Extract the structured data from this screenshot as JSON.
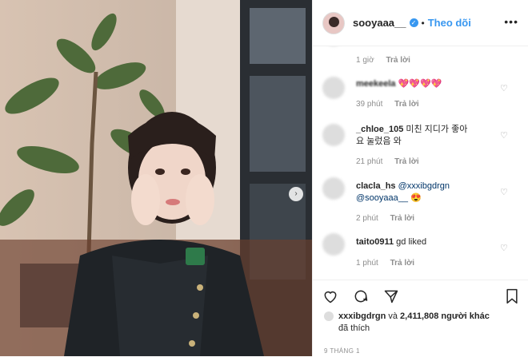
{
  "post": {
    "photo_alt": "photo",
    "next_icon": "chevron-right-icon"
  },
  "header": {
    "username": "sooyaaa__",
    "verified_icon": "verified-badge-icon",
    "separator": "•",
    "follow_label": "Theo dõi",
    "more_icon": "more-options-icon",
    "more_label": "•••"
  },
  "comments": [
    {
      "user": "",
      "text": "",
      "time": "1 giờ",
      "reply": "Trả lời"
    },
    {
      "user": "meekeela",
      "text": "💖💖💖💖",
      "time": "39 phút",
      "reply": "Trả lời"
    },
    {
      "user": "_chloe_105",
      "text": "미친 지디가 좋아요 눌렀음 와",
      "time": "21 phút",
      "reply": "Trả lời"
    },
    {
      "user": "clacla_hs",
      "text_mention1": "@xxxibgdrgn",
      "text_mention2": "@sooyaaa__",
      "text_emoji": "😍",
      "time": "2 phút",
      "reply": "Trả lời"
    },
    {
      "user": "taito0911",
      "text": "gd liked",
      "time": "1 phút",
      "reply": "Trả lời"
    }
  ],
  "actions": {
    "like_icon": "heart-icon",
    "comment_icon": "comment-icon",
    "share_icon": "share-icon",
    "save_icon": "bookmark-icon"
  },
  "likes": {
    "first_liker": "xxxibgdrgn",
    "conjunction": "và",
    "others": "2,411,808 người khác",
    "suffix": "đã thích"
  },
  "date": "9 THÁNG 1"
}
